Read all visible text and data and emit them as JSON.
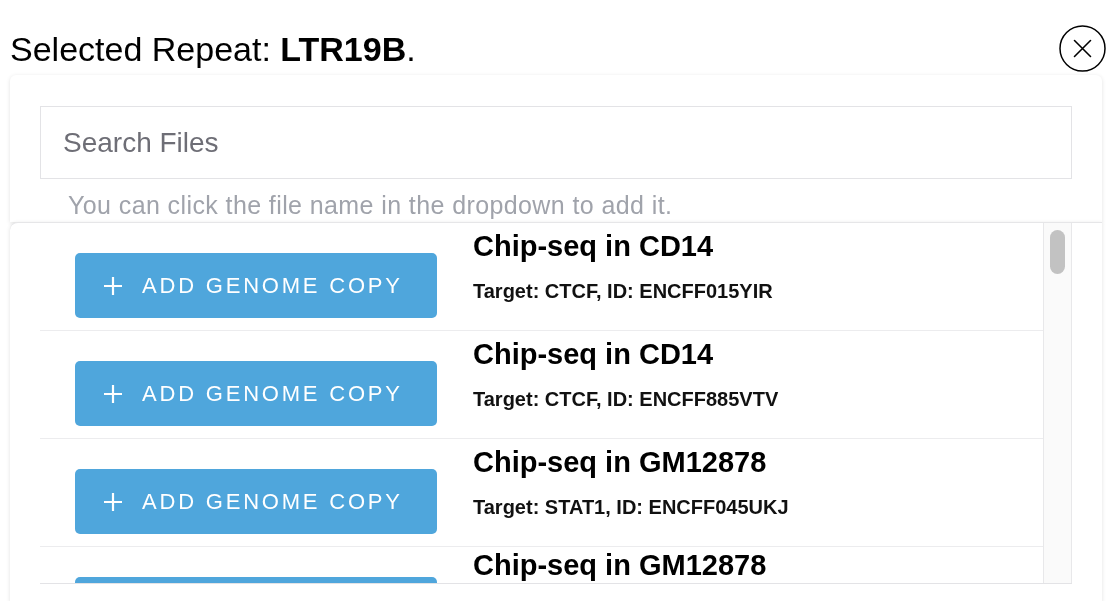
{
  "header": {
    "title": "Selected Repeat: **LTR19B**."
  },
  "search": {
    "placeholder": "Search Files",
    "hint": "You can click the file name in the dropdown to add it."
  },
  "files": [
    {
      "button_label": "ADD GENOME COPY",
      "title": "Chip-seq in CD14",
      "subtitle": "Target: CTCF, ID: ENCFF015YIR"
    },
    {
      "button_label": "ADD GENOME COPY",
      "title": "Chip-seq in CD14",
      "subtitle": "Target: CTCF, ID: ENCFF885VTV"
    },
    {
      "button_label": "ADD GENOME COPY",
      "title": "Chip-seq in GM12878",
      "subtitle": "Target: STAT1, ID: ENCFF045UKJ"
    },
    {
      "title": "Chip-seq in GM12878"
    }
  ]
}
